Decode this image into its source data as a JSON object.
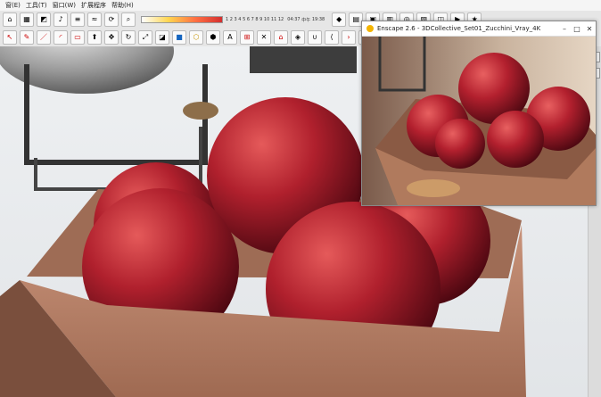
{
  "menu": {
    "items": [
      "窗(E)",
      "工具(T)",
      "窗口(W)",
      "扩展程序",
      "帮助(H)"
    ]
  },
  "toolbar_top": {
    "scale_ticks": "1 2 3 4 5 6 7 8 9 10 11 12",
    "time_left": "04:37",
    "time_mid": "中午",
    "time_right": "19:38"
  },
  "enscape_window": {
    "title": "Enscape 2.6 - 3DCollective_Set01_Zucchini_Vray_4K",
    "minimize": "–",
    "maximize": "□",
    "close": "✕"
  },
  "colors": {
    "plum": "#b0202d",
    "bowl": "#b87d60",
    "toolbar": "#e6e6e6"
  },
  "icons": [
    "home-icon",
    "measure-icon",
    "paint-bucket-icon",
    "speaker-icon",
    "shadow-icon",
    "fog-icon",
    "orbit-icon",
    "zoom-icon",
    "ruby-icon",
    "play-icon",
    "enscape-icon"
  ]
}
